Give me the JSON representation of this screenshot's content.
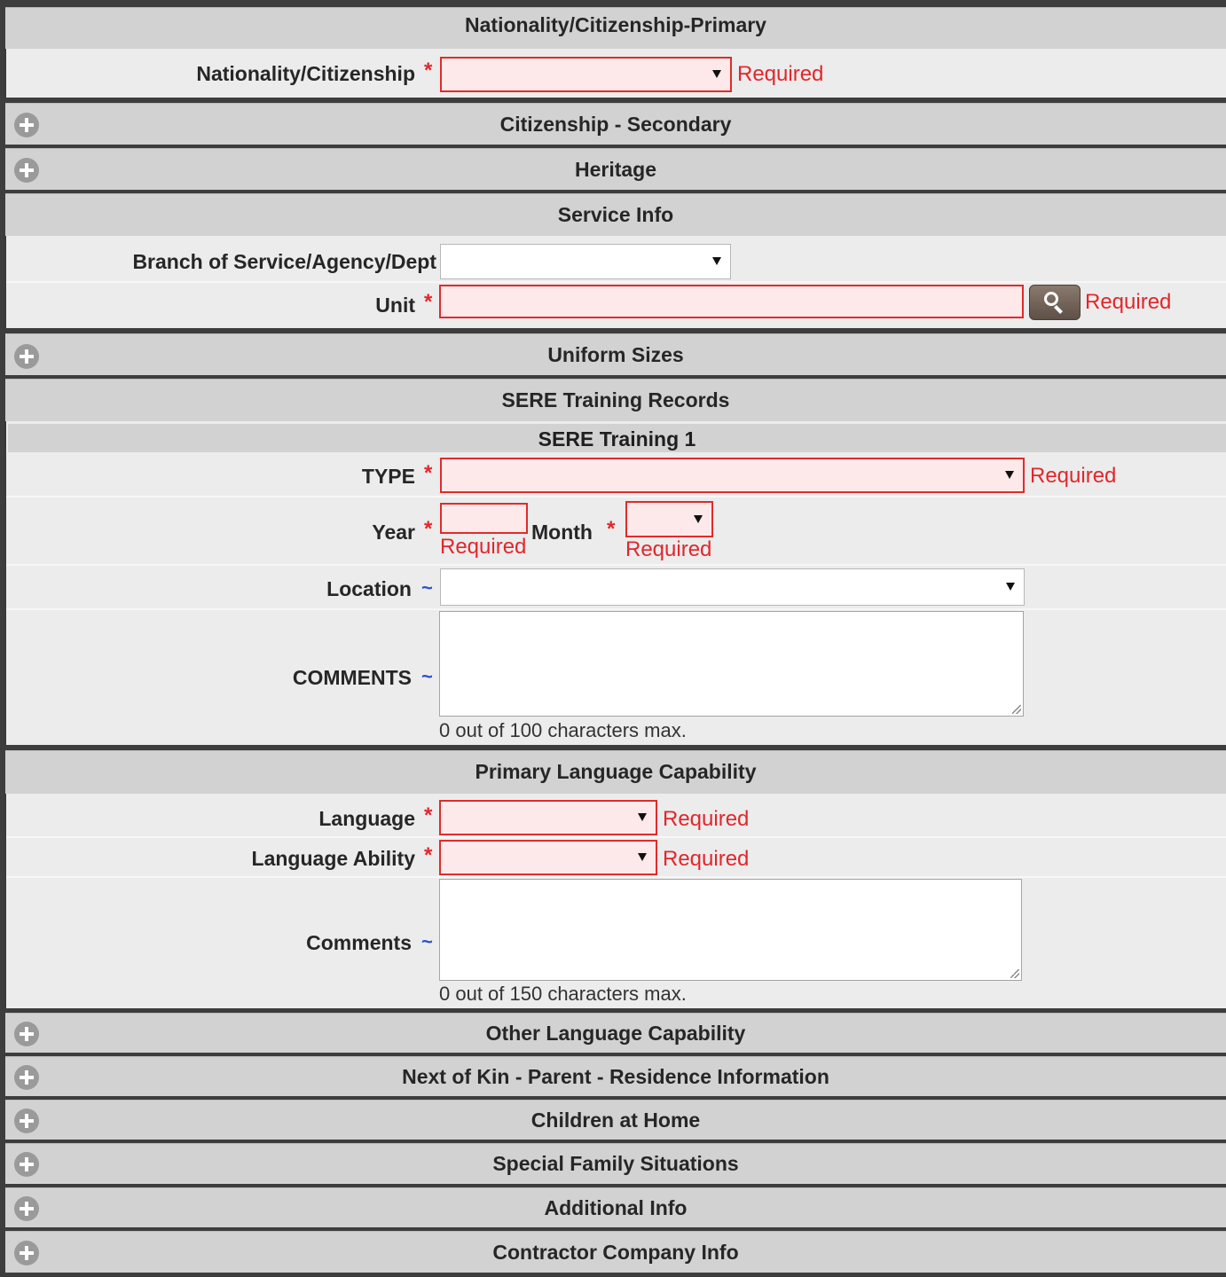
{
  "sections": {
    "nationality_primary": "Nationality/Citizenship-Primary",
    "citizenship_secondary": "Citizenship - Secondary",
    "heritage": "Heritage",
    "service_info": "Service Info",
    "uniform_sizes": "Uniform Sizes",
    "sere_records": "SERE Training Records",
    "sere_training_1": "SERE Training 1",
    "primary_language": "Primary Language Capability",
    "other_language": "Other Language Capability",
    "next_of_kin": "Next of Kin - Parent - Residence Information",
    "children_home": "Children at Home",
    "special_family": "Special Family Situations",
    "additional_info": "Additional Info",
    "contractor_info": "Contractor Company Info"
  },
  "labels": {
    "nationality": "Nationality/Citizenship",
    "branch": "Branch of Service/Agency/Dept",
    "unit": "Unit",
    "type": "TYPE",
    "year": "Year",
    "month": "Month",
    "location": "Location",
    "comments_sere": "COMMENTS",
    "language": "Language",
    "language_ability": "Language Ability",
    "comments_lang": "Comments"
  },
  "markers": {
    "required_star": "*",
    "optional_tilde": "~"
  },
  "validation": {
    "required": "Required"
  },
  "counters": {
    "sere_comments": "0 out of 100 characters max.",
    "lang_comments": "0 out of 150 characters max."
  },
  "icons": {
    "expand": "plus-circle-icon",
    "lookup": "magnifier-icon"
  },
  "colors": {
    "required_red": "#e3262b",
    "optional_blue": "#2b50c8",
    "header_bg": "#d2d2d2",
    "header_rule": "#4f6b3c"
  }
}
